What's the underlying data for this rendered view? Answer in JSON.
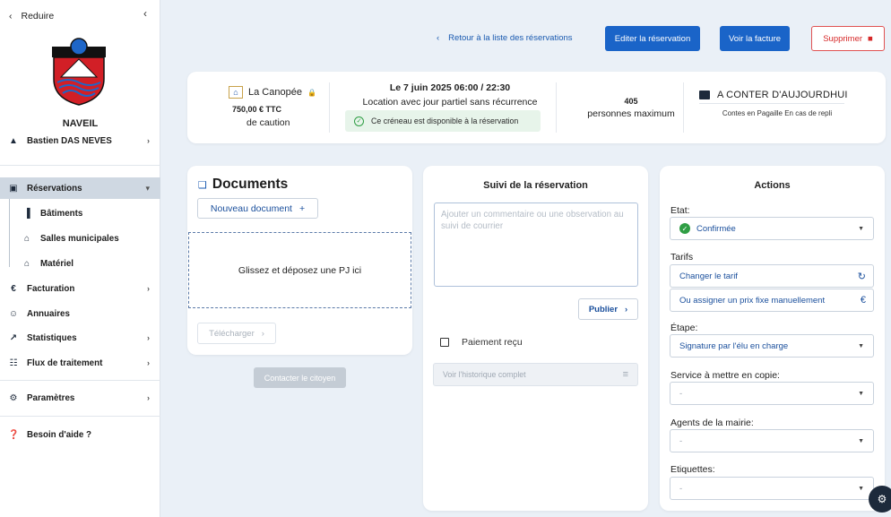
{
  "sidebar": {
    "reduire": "Reduire",
    "town": "NAVEIL",
    "user": "Bastien DAS NEVES",
    "items": {
      "reservations": "Réservations",
      "batiments": "Bâtiments",
      "salles": "Salles municipales",
      "materiel": "Matériel",
      "facturation": "Facturation",
      "annuaires": "Annuaires",
      "statistiques": "Statistiques",
      "flux": "Flux de traitement",
      "parametres": "Paramètres",
      "aide": "Besoin d'aide ?"
    }
  },
  "topbar": {
    "back": "Retour à la liste des réservations",
    "edit": "Editer la réservation",
    "invoice": "Voir la facture",
    "delete": "Supprimer"
  },
  "info": {
    "venue": "La Canopée",
    "price": "750,00 € TTC",
    "caution": "de caution",
    "date": "Le 7 juin 2025  06:00 / 22:30",
    "location": "Location avec jour partiel sans récurrence",
    "available": "Ce créneau est disponible à la réservation",
    "capacity": "405",
    "capacity_label": "personnes maximum",
    "event_title": "A CONTER D'AUJOURDHUI",
    "event_sub": "Contes en Pagaille En cas de repli"
  },
  "documents": {
    "title": "Documents",
    "new": "Nouveau document",
    "drop": "Glissez et déposez une PJ ici",
    "download": "Télécharger",
    "contact": "Contacter le citoyen"
  },
  "suivi": {
    "title": "Suivi de la réservation",
    "placeholder": "Ajouter un commentaire ou une observation au suivi de courrier",
    "publish": "Publier",
    "paid": "Paiement reçu",
    "history": "Voir l'historique complet"
  },
  "actions": {
    "title": "Actions",
    "etat_label": "Etat:",
    "etat_value": "Confirmée",
    "tarifs_label": "Tarifs",
    "change_tarif": "Changer le tarif",
    "fixed_price": "Ou assigner un prix fixe manuellement",
    "etape_label": "Étape:",
    "etape_value": "Signature par l'élu en charge",
    "service_label": "Service à mettre en copie:",
    "service_value": "-",
    "agents_label": "Agents de la mairie:",
    "agents_value": "-",
    "etiquettes_label": "Etiquettes:",
    "etiquettes_value": "-"
  },
  "colors": {
    "primary": "#1a64c8",
    "danger": "#d62828",
    "success": "#2f9e44",
    "background": "#eaf0f7"
  }
}
